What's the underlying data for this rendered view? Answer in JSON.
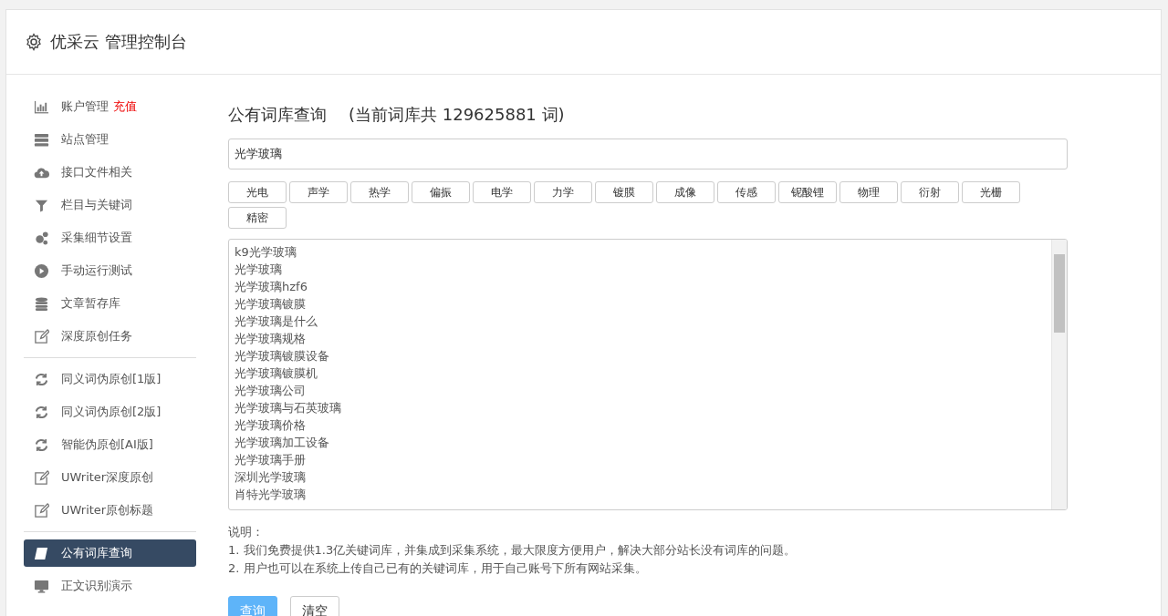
{
  "header": {
    "title": "优采云 管理控制台"
  },
  "sidebar": {
    "groups": [
      [
        {
          "label": "账户管理",
          "badge": "充值",
          "selected": false
        },
        {
          "label": "站点管理",
          "selected": false
        },
        {
          "label": "接口文件相关",
          "selected": false
        },
        {
          "label": "栏目与关键词",
          "selected": false
        },
        {
          "label": "采集细节设置",
          "selected": false
        },
        {
          "label": "手动运行测试",
          "selected": false
        },
        {
          "label": "文章暂存库",
          "selected": false
        },
        {
          "label": "深度原创任务",
          "selected": false
        }
      ],
      [
        {
          "label": "同义词伪原创[1版]",
          "selected": false
        },
        {
          "label": "同义词伪原创[2版]",
          "selected": false
        },
        {
          "label": "智能伪原创[AI版]",
          "selected": false
        },
        {
          "label": "UWriter深度原创",
          "selected": false
        },
        {
          "label": "UWriter原创标题",
          "selected": false
        }
      ],
      [
        {
          "label": "公有词库查询",
          "selected": true
        },
        {
          "label": "正文识别演示",
          "selected": false
        }
      ]
    ]
  },
  "main": {
    "title": "公有词库查询",
    "count": "(当前词库共 129625881 词)",
    "search": {
      "value": "光学玻璃"
    },
    "tags": [
      "光电",
      "声学",
      "热学",
      "偏振",
      "电学",
      "力学",
      "镀膜",
      "成像",
      "传感",
      "铌酸锂",
      "物理",
      "衍射",
      "光栅",
      "精密"
    ],
    "results": [
      "k9光学玻璃",
      "光学玻璃",
      "光学玻璃hzf6",
      "光学玻璃镀膜",
      "光学玻璃是什么",
      "光学玻璃规格",
      "光学玻璃镀膜设备",
      "光学玻璃镀膜机",
      "光学玻璃公司",
      "光学玻璃与石英玻璃",
      "光学玻璃价格",
      "光学玻璃加工设备",
      "光学玻璃手册",
      "深圳光学玻璃",
      "肖特光学玻璃"
    ],
    "notes": {
      "label": "说明：",
      "lines": [
        "1. 我们免费提供1.3亿关键词库，并集成到采集系统，最大限度方便用户，解决大部分站长没有词库的问题。",
        "2. 用户也可以在系统上传自己已有的关键词库，用于自己账号下所有网站采集。"
      ]
    },
    "buttons": [
      {
        "label": "查询",
        "kind": "primary"
      },
      {
        "label": "清空",
        "kind": "default"
      }
    ]
  }
}
